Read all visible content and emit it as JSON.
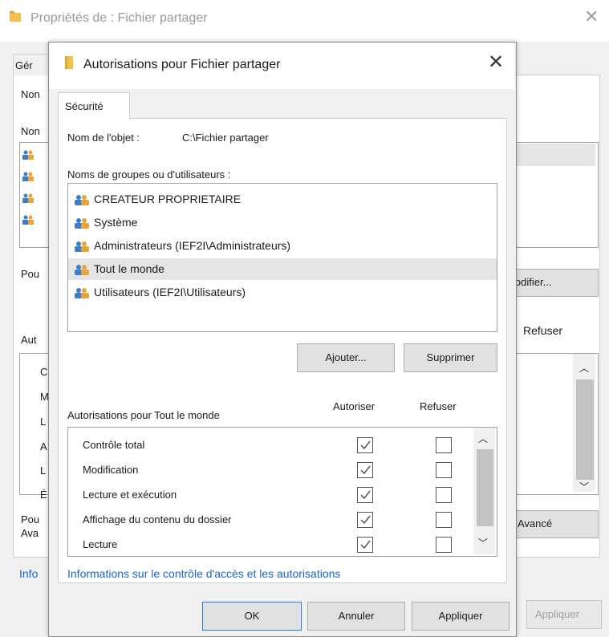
{
  "background_dialog": {
    "title": "Propriétés de : Fichier partager",
    "tab_partial": "Gér",
    "label_nom1": "Non",
    "label_nom2": "Non",
    "label_pour": "Pou",
    "modifier_partial": "lodifier...",
    "label_auto": "Aut",
    "refuser_header": "Refuser",
    "perm_letters": [
      "C",
      "M",
      "L",
      "A",
      "L",
      "É"
    ],
    "label_pour2": "Pou",
    "label_ava": "Ava",
    "avance_label": "Avancé",
    "info_partial": "Info",
    "appliquer_label": "Appliquer"
  },
  "dialog": {
    "title": "Autorisations pour Fichier partager",
    "tab": "Sécurité",
    "object_label": "Nom de l'objet :",
    "object_value": "C:\\Fichier partager",
    "groups_label": "Noms de groupes ou d'utilisateurs :",
    "groups": [
      {
        "name": "CREATEUR PROPRIETAIRE",
        "selected": false
      },
      {
        "name": "Système",
        "selected": false
      },
      {
        "name": "Administrateurs (IEF2I\\Administrateurs)",
        "selected": false
      },
      {
        "name": "Tout le monde",
        "selected": true
      },
      {
        "name": "Utilisateurs (IEF2I\\Utilisateurs)",
        "selected": false
      }
    ],
    "btn_add": "Ajouter...",
    "btn_remove": "Supprimer",
    "permissions_title": "Autorisations pour Tout le monde",
    "col_allow": "Autoriser",
    "col_deny": "Refuser",
    "permissions": [
      {
        "name": "Contrôle total",
        "allow": true,
        "deny": false
      },
      {
        "name": "Modification",
        "allow": true,
        "deny": false
      },
      {
        "name": "Lecture et exécution",
        "allow": true,
        "deny": false
      },
      {
        "name": "Affichage du contenu du dossier",
        "allow": true,
        "deny": false
      },
      {
        "name": "Lecture",
        "allow": true,
        "deny": false
      }
    ],
    "info_link": "Informations sur le contrôle d'accès et les autorisations",
    "btn_ok": "OK",
    "btn_cancel": "Annuler",
    "btn_apply": "Appliquer"
  },
  "colors": {
    "accent": "#2b78d6",
    "link": "#1a66c6",
    "folder": "#e8b339"
  },
  "icons": {
    "folder": "folder-icon",
    "users": "users-group-icon",
    "close": "close-icon"
  }
}
